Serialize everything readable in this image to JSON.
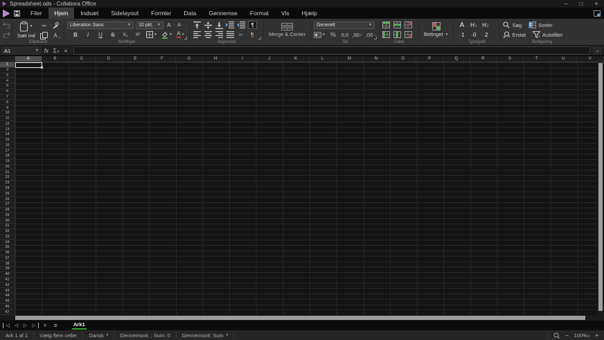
{
  "window": {
    "title": "Spreadsheet.ods - Collabora Office",
    "minimize": "–",
    "maximize": "□",
    "close": "×"
  },
  "menubar": {
    "items": [
      {
        "label": "Filer"
      },
      {
        "label": "Hjem",
        "active": true
      },
      {
        "label": "Indsæt"
      },
      {
        "label": "Sidelayout"
      },
      {
        "label": "Formler"
      },
      {
        "label": "Data"
      },
      {
        "label": "Gennemse"
      },
      {
        "label": "Format"
      },
      {
        "label": "Vis"
      },
      {
        "label": "Hjælp"
      }
    ]
  },
  "ribbon": {
    "clipboard": {
      "paste_label": "Sæt ind",
      "group_label": "Clipboard"
    },
    "font": {
      "group_label": "Skrifttype",
      "font_name": "Liberation Sans",
      "font_size": "10 pkt.",
      "bold": "B",
      "italic": "I",
      "underline": "U",
      "strike": "S",
      "subscript": "X₂",
      "superscript": "X²",
      "letter_a": "A",
      "grow_arrow": "↑",
      "shrink_arrow": "↓"
    },
    "alignment": {
      "group_label": "Alignment",
      "paragraph_mark": "¶",
      "wrap_mark": "↵"
    },
    "merge": {
      "label": "Merge & Center"
    },
    "number": {
      "group_label": "Tal",
      "format_value": "Generelt",
      "percent": "%",
      "thousands": "0,0",
      "add_decimal": ",00",
      "del_decimal": ",00",
      "add_arrow": "↙",
      "del_arrow": "↘",
      "currency_glyph": "¤"
    },
    "cells": {
      "group_label": "Celler"
    },
    "conditional": {
      "label": "Betinget"
    },
    "styles": {
      "group_label": "Typografi",
      "default": "A",
      "h1_base": "H",
      "h1_num": "1",
      "h2_base": "H",
      "h2_num": "2",
      "good_mark": "-",
      "good_num": "1",
      "neutral_mark": "-",
      "neutral_num": "0",
      "bad_mark": "-",
      "bad_num": "2"
    },
    "editing": {
      "group_label": "Redigering",
      "search": "Søg",
      "sort": "Sortér",
      "replace": "Erstat",
      "autofilter": "Autofilter"
    }
  },
  "formula_bar": {
    "cell_reference": "A1",
    "fx_label": "fx",
    "sum_label": "Σ",
    "equals_label": "=",
    "input_value": "",
    "expand_glyph": "⌄"
  },
  "grid": {
    "columns": [
      "A",
      "B",
      "C",
      "D",
      "E",
      "F",
      "G",
      "H",
      "I",
      "J",
      "K",
      "L",
      "M",
      "N",
      "O",
      "P",
      "Q",
      "R",
      "S",
      "T",
      "U",
      "V"
    ],
    "visible_rows": 47,
    "selected_cell": "A1",
    "selected_column": "A",
    "selected_row": "1"
  },
  "sheet_bar": {
    "nav_first": "◁",
    "nav_prev": "◁",
    "nav_next": "▷",
    "nav_last": "▷",
    "add_sheet": "+",
    "sheet_menu": "≡",
    "tabs": [
      {
        "label": "Ark1",
        "active": true
      }
    ]
  },
  "status_bar": {
    "sheet_info": "Ark 1 af 1",
    "selection_mode": "Vælg flere celler",
    "language": "Dansk",
    "stats": "Gennemsnit: ; Sum: 0",
    "stats_menu": "Gennemsnit; Sum",
    "zoom_out": "–",
    "zoom_level": "100%",
    "zoom_in": "+"
  },
  "glyphs": {
    "dropdown": "▼",
    "dropdown_small": "▾",
    "cut": "✂"
  },
  "colors": {
    "active_tab_underline": "#2ea52e",
    "selection_border": "#d9ecd9",
    "selection_handle": "#3aa73a",
    "accent_blue": "#5b9bd5",
    "good_green": "#4caf50",
    "bad_red": "#d04a4a",
    "neutral_yellow": "#e0a030",
    "logo_purple": "#9a5fb5"
  }
}
